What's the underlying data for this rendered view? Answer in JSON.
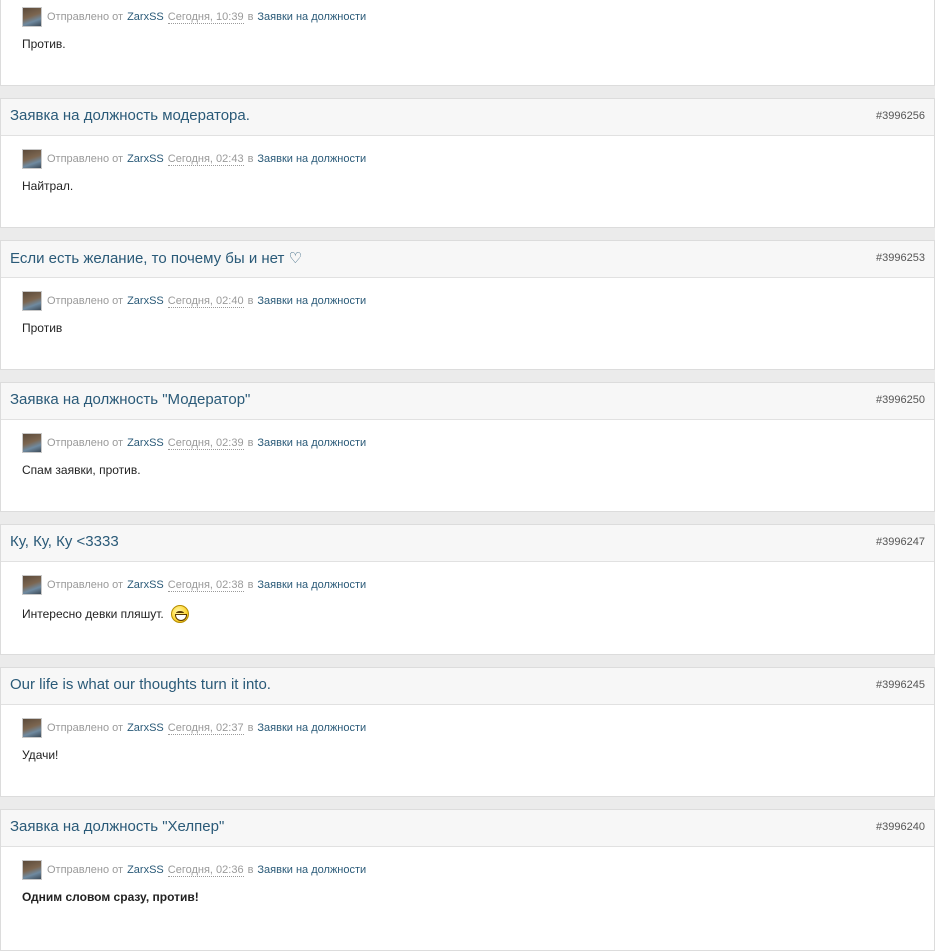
{
  "labels": {
    "sent_prefix": "Отправлено от",
    "in_word": "в"
  },
  "posts": [
    {
      "title": "",
      "post_id": "",
      "author": "ZarxSS",
      "date": "Сегодня, 10:39",
      "category": "Заявки на должности",
      "text": "Против.",
      "bold": false,
      "smiley": false
    },
    {
      "title": "Заявка на должность модератора.",
      "post_id": "#3996256",
      "author": "ZarxSS",
      "date": "Сегодня, 02:43",
      "category": "Заявки на должности",
      "text": "Найтрал.",
      "bold": false,
      "smiley": false
    },
    {
      "title": "Если есть желание, то почему бы и нет ♡",
      "post_id": "#3996253",
      "author": "ZarxSS",
      "date": "Сегодня, 02:40",
      "category": "Заявки на должности",
      "text": "Против",
      "bold": false,
      "smiley": false
    },
    {
      "title": "Заявка на должность \"Модератор\"",
      "post_id": "#3996250",
      "author": "ZarxSS",
      "date": "Сегодня, 02:39",
      "category": "Заявки на должности",
      "text": "Спам заявки, против.",
      "bold": false,
      "smiley": false
    },
    {
      "title": "Ку, Ку, Ку <3333",
      "post_id": "#3996247",
      "author": "ZarxSS",
      "date": "Сегодня, 02:38",
      "category": "Заявки на должности",
      "text": "Интересно девки пляшут.",
      "bold": false,
      "smiley": true
    },
    {
      "title": "Our life is what our thoughts turn it into.",
      "post_id": "#3996245",
      "author": "ZarxSS",
      "date": "Сегодня, 02:37",
      "category": "Заявки на должности",
      "text": "Удачи!",
      "bold": false,
      "smiley": false
    },
    {
      "title": "Заявка на должность \"Хелпер\"",
      "post_id": "#3996240",
      "author": "ZarxSS",
      "date": "Сегодня, 02:36",
      "category": "Заявки на должности",
      "text": "Одним словом сразу, против!",
      "bold": true,
      "smiley": false
    }
  ]
}
